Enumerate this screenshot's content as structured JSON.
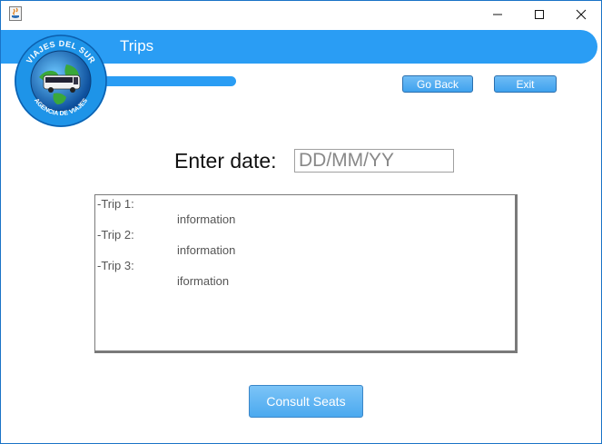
{
  "window": {
    "controls": {
      "minimize": "minimize-icon",
      "maximize": "maximize-icon",
      "close": "close-icon"
    }
  },
  "header": {
    "title": "Trips",
    "logo": {
      "top_text": "VIAJES DEL SUR",
      "bottom_text": "AGENCIA DE VIAJES"
    }
  },
  "nav": {
    "go_back_label": "Go Back",
    "exit_label": "Exit"
  },
  "date": {
    "label": "Enter date:",
    "value": "",
    "placeholder": "DD/MM/YY"
  },
  "trips": [
    {
      "label": "-Trip 1:",
      "info": "information"
    },
    {
      "label": "-Trip 2:",
      "info": "information"
    },
    {
      "label": "-Trip 3:",
      "info": "iformation"
    }
  ],
  "actions": {
    "consult_label": "Consult Seats"
  },
  "colors": {
    "accent": "#2a9df4",
    "button": "#4ba9ef"
  }
}
